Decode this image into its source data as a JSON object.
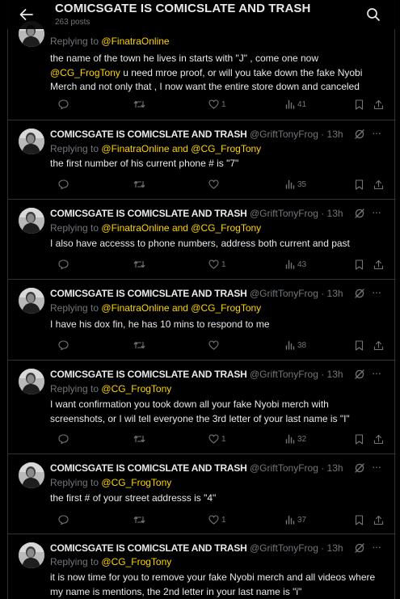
{
  "header": {
    "title": "COMICSGATE IS COMICSLATE AND TRASH",
    "subtitle": "263 posts"
  },
  "colors": {
    "mention": "#ffd400",
    "muted": "#71767b",
    "divider": "#2f3336"
  },
  "tweets": [
    {
      "author": "",
      "handle": "",
      "reply_prefix": "Replying to",
      "reply_to": "@FinatraOnline",
      "text": "the name of the town he lives in starts with \"J\" , come one now",
      "text_mention": "@CG_FrogTony",
      "text_rest": " u need mroe proof, or will you take down the fake Nyobi Merch and not only that , I now want the entire store down and canceled",
      "likes": "1",
      "views": "41"
    },
    {
      "author": "COMICSGATE IS COMICSLATE AND TRASH",
      "handle": "@GriftTonyFrog · 13h",
      "reply_prefix": "Replying to",
      "reply_to": "@FinatraOnline and @CG_FrogTony",
      "text": "the first number of his current phone # is \"7\"",
      "likes": "",
      "views": "35"
    },
    {
      "author": "COMICSGATE IS COMICSLATE AND TRASH",
      "handle": "@GriftTonyFrog · 13h",
      "reply_prefix": "Replying to",
      "reply_to": "@FinatraOnline and @CG_FrogTony",
      "text": "I also have accesss to phone numbers, address both current and past",
      "likes": "1",
      "views": "43"
    },
    {
      "author": "COMICSGATE IS COMICSLATE AND TRASH",
      "handle": "@GriftTonyFrog · 13h",
      "reply_prefix": "Replying to",
      "reply_to": "@FinatraOnline and @CG_FrogTony",
      "text": "I have his dox fin, he has 10 mins to respond to me",
      "likes": "",
      "views": "38"
    },
    {
      "author": "COMICSGATE IS COMICSLATE AND TRASH",
      "handle": "@GriftTonyFrog · 13h",
      "reply_prefix": "Replying to",
      "reply_to": "@CG_FrogTony",
      "text": "I want confirmation you took down all your fake Nyobi merch with screenshots, or I wil tell everyone the 3rd letter of your last name is \"I\"",
      "likes": "1",
      "views": "32"
    },
    {
      "author": "COMICSGATE IS COMICSLATE AND TRASH",
      "handle": "@GriftTonyFrog · 13h",
      "reply_prefix": "Replying to",
      "reply_to": "@CG_FrogTony",
      "text": "the first # of your street addresss is \"4\"",
      "likes": "1",
      "views": "37"
    },
    {
      "author": "COMICSGATE IS COMICSLATE AND TRASH",
      "handle": "@GriftTonyFrog · 13h",
      "reply_prefix": "Replying to",
      "reply_to": "@CG_FrogTony",
      "text": "it is now time for you to remove your fake Nyobi merch and all videos where my name is mentions, the 2nd letter in your last name is \"i\"",
      "likes": "",
      "views": ""
    }
  ],
  "more_label": "···"
}
